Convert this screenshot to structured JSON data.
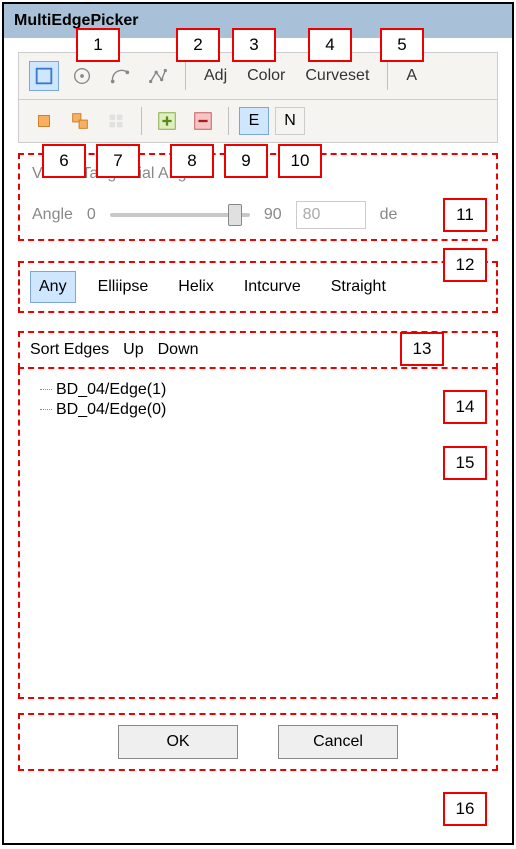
{
  "window": {
    "title": "MultiEdgePicker"
  },
  "toolbar": {
    "adj": "Adj",
    "color": "Color",
    "curveset": "Curveset",
    "a": "A",
    "e": "E",
    "n": "N"
  },
  "tangential": {
    "title": "Vertex Tangential Angle",
    "angle_label": "Angle",
    "min": "0",
    "max": "90",
    "value": "80",
    "unit": "de"
  },
  "filters": {
    "any": "Any",
    "ellipse": "Elliipse",
    "helix": "Helix",
    "intcurve": "Intcurve",
    "straight": "Straight"
  },
  "sort": {
    "label": "Sort Edges",
    "up": "Up",
    "down": "Down"
  },
  "tree": {
    "items": [
      "BD_04/Edge(1)",
      "BD_04/Edge(0)"
    ]
  },
  "buttons": {
    "ok": "OK",
    "cancel": "Cancel"
  },
  "callouts": [
    "1",
    "2",
    "3",
    "4",
    "5",
    "6",
    "7",
    "8",
    "9",
    "10",
    "11",
    "12",
    "13",
    "14",
    "15",
    "16"
  ]
}
